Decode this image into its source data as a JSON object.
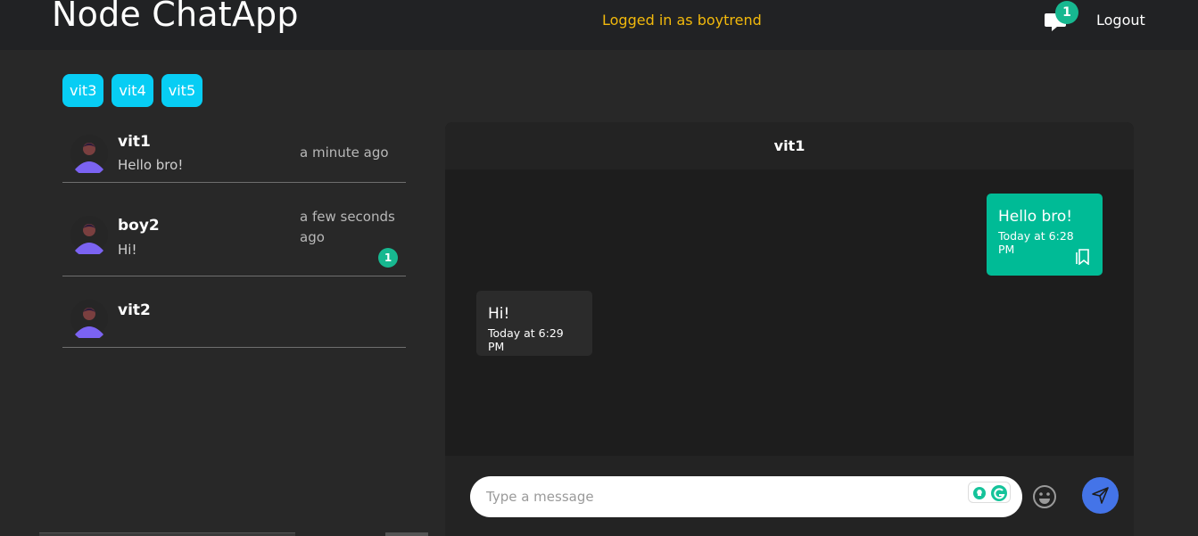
{
  "navbar": {
    "brand": "Node ChatApp",
    "logged_in": "Logged in as boytrend",
    "notification_count": "1",
    "logout": "Logout"
  },
  "online_users": [
    {
      "label": "vit3"
    },
    {
      "label": "vit4"
    },
    {
      "label": "vit5"
    }
  ],
  "conversations": [
    {
      "name": "vit1",
      "last_message": "Hello bro!",
      "time": "a minute ago",
      "unread": ""
    },
    {
      "name": "boy2",
      "last_message": "Hi!",
      "time": "a few seconds ago",
      "unread": "1"
    },
    {
      "name": "vit2",
      "last_message": "",
      "time": "",
      "unread": ""
    }
  ],
  "chat": {
    "title": "vit1",
    "messages": [
      {
        "direction": "sent",
        "text": "Hello bro!",
        "time": "Today at 6:28 PM"
      },
      {
        "direction": "received",
        "text": "Hi!",
        "time": "Today at 6:29 PM"
      }
    ],
    "input_placeholder": "Type a message"
  },
  "colors": {
    "accent_chip": "#07cdf4",
    "sent_bubble": "#00bb96",
    "badge": "#17b890",
    "send_button": "#4474e8",
    "logged_text": "#f2b90c"
  },
  "icons": [
    "chat-bubble-icon",
    "avatar-icon",
    "bookmark-icon",
    "emoji-icon",
    "send-icon",
    "grammarly-icon"
  ]
}
